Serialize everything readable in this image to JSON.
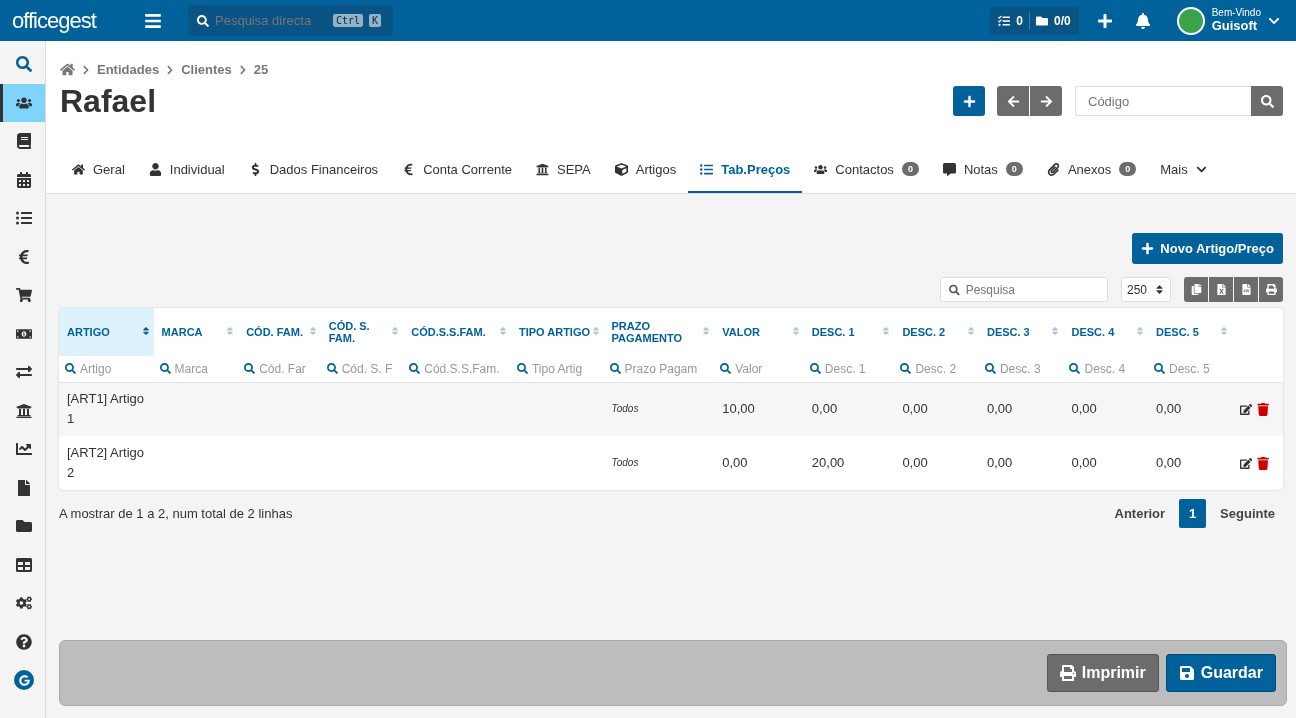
{
  "topbar": {
    "logo": "officegest",
    "search": {
      "placeholder": "Pesquisa directa",
      "keys": [
        "Ctrl",
        "K"
      ]
    },
    "tasks_count": "0",
    "folders_count": "0/0",
    "greeting": "Bem-Vindo",
    "user": "Guisoft"
  },
  "sidebar": {
    "items": [
      {
        "selected": false
      },
      {
        "selected": true
      },
      {
        "selected": false
      },
      {
        "selected": false
      },
      {
        "selected": false
      },
      {
        "selected": false
      },
      {
        "selected": false
      },
      {
        "selected": false
      },
      {
        "selected": false
      },
      {
        "selected": false
      },
      {
        "selected": false
      },
      {
        "selected": false
      },
      {
        "selected": false
      },
      {
        "selected": false
      },
      {
        "selected": false
      },
      {
        "selected": false
      }
    ]
  },
  "breadcrumb": [
    "Entidades",
    "Clientes",
    "25"
  ],
  "title": "Rafael",
  "code_search": {
    "placeholder": "Código"
  },
  "tabs": [
    {
      "label": "Geral",
      "selected": false
    },
    {
      "label": "Individual",
      "selected": false
    },
    {
      "label": "Dados Financeiros",
      "selected": false
    },
    {
      "label": "Conta Corrente",
      "selected": false
    },
    {
      "label": "SEPA",
      "selected": false
    },
    {
      "label": "Artigos",
      "selected": false
    },
    {
      "label": "Tab.Preços",
      "selected": true
    },
    {
      "label": "Contactos",
      "badge": "0",
      "selected": false
    },
    {
      "label": "Notas",
      "badge": "0",
      "selected": false
    },
    {
      "label": "Anexos",
      "badge": "0",
      "selected": false
    },
    {
      "label": "Mais",
      "selected": false
    }
  ],
  "new_button": "Novo Artigo/Preço",
  "table_search": {
    "placeholder": "Pesquisa"
  },
  "page_size": "250",
  "table": {
    "columns": [
      {
        "label": "ARTIGO",
        "placeholder": "Artigo",
        "sorted": true,
        "kind": "text"
      },
      {
        "label": "MARCA",
        "placeholder": "Marca",
        "sorted": false,
        "kind": "text"
      },
      {
        "label": "CÓD. FAM.",
        "placeholder": "Cód. Far",
        "sorted": false,
        "kind": "text"
      },
      {
        "label": "CÓD. S. FAM.",
        "placeholder": "Cód. S. F",
        "sorted": false,
        "kind": "text"
      },
      {
        "label": "CÓD.S.S.FAM.",
        "placeholder": "Cód.S.S.Fam.",
        "sorted": false,
        "kind": "text"
      },
      {
        "label": "TIPO ARTIGO",
        "placeholder": "Tipo Artig",
        "sorted": false,
        "kind": "text"
      },
      {
        "label": "PRAZO PAGAMENTO",
        "placeholder": "Prazo Pagam",
        "sorted": false,
        "kind": "note"
      },
      {
        "label": "VALOR",
        "placeholder": "Valor",
        "sorted": false,
        "kind": "text"
      },
      {
        "label": "DESC. 1",
        "placeholder": "Desc. 1",
        "sorted": false,
        "kind": "text"
      },
      {
        "label": "DESC. 2",
        "placeholder": "Desc. 2",
        "sorted": false,
        "kind": "text"
      },
      {
        "label": "DESC. 3",
        "placeholder": "Desc. 3",
        "sorted": false,
        "kind": "text"
      },
      {
        "label": "DESC. 4",
        "placeholder": "Desc. 4",
        "sorted": false,
        "kind": "text"
      },
      {
        "label": "DESC. 5",
        "placeholder": "Desc. 5",
        "sorted": false,
        "kind": "text"
      }
    ],
    "rows": [
      {
        "cells": [
          "[ART1] Artigo 1",
          "",
          "",
          "",
          "",
          "",
          "Todos",
          "10,00",
          "0,00",
          "0,00",
          "0,00",
          "0,00",
          "0,00"
        ]
      },
      {
        "cells": [
          "[ART2] Artigo 2",
          "",
          "",
          "",
          "",
          "",
          "Todos",
          "0,00",
          "20,00",
          "0,00",
          "0,00",
          "0,00",
          "0,00"
        ]
      }
    ]
  },
  "info": "A mostrar de 1 a 2, num total de 2 linhas",
  "pagination": {
    "previous": "Anterior",
    "pages": [
      {
        "label": "1",
        "selected": true
      }
    ],
    "next": "Seguinte"
  },
  "footer_buttons": [
    {
      "label": "Imprimir",
      "kind": "secondary"
    },
    {
      "label": "Guardar",
      "kind": "primary"
    }
  ]
}
